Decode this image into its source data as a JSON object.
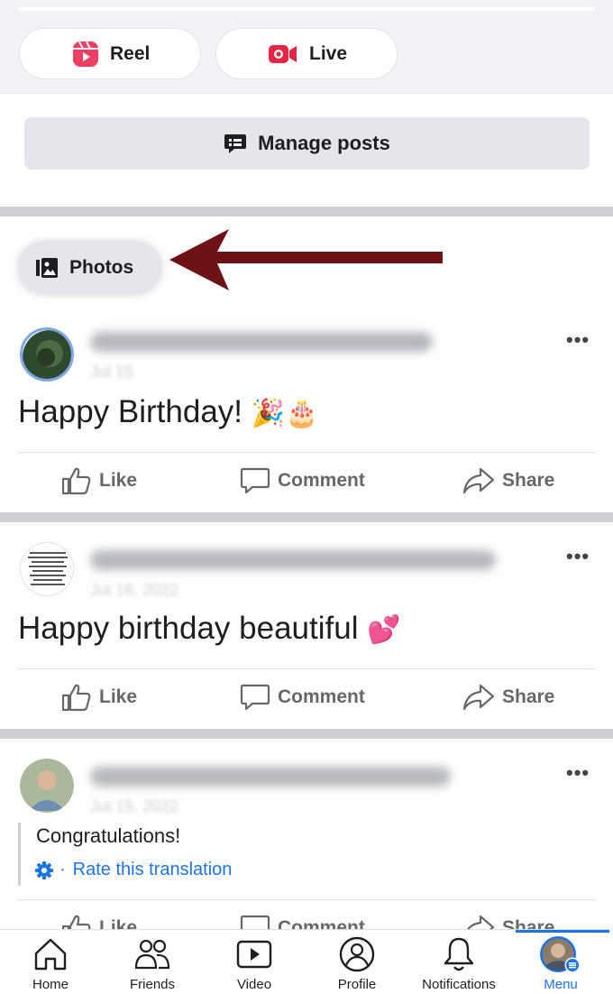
{
  "create_row": {
    "reel_label": "Reel",
    "live_label": "Live",
    "reel_icon": "reel-icon",
    "live_icon": "live-video-icon",
    "reel_color": "#ef3e63",
    "live_color": "#e42645"
  },
  "manage": {
    "label": "Manage posts",
    "icon": "speech-bubble-icon"
  },
  "photos": {
    "label": "Photos",
    "icon": "photo-album-icon",
    "annotation_color": "#6e1216"
  },
  "posts": [
    {
      "text": "Happy Birthday! ",
      "emoji": "🎉🎂",
      "date": "Jul 15"
    },
    {
      "text": "Happy birthday beautiful ",
      "emoji": "💕",
      "date": "Jul 16, 2022"
    },
    {
      "date": "Jul 15, 2022",
      "translation": "Congratulations!",
      "rate_translation": "Rate this translation"
    }
  ],
  "actions": {
    "like": "Like",
    "comment": "Comment",
    "share": "Share"
  },
  "nav": [
    {
      "label": "Home",
      "icon": "home-icon"
    },
    {
      "label": "Friends",
      "icon": "friends-icon"
    },
    {
      "label": "Video",
      "icon": "video-icon"
    },
    {
      "label": "Profile",
      "icon": "profile-icon"
    },
    {
      "label": "Notifications",
      "icon": "bell-icon"
    },
    {
      "label": "Menu",
      "icon": "menu-avatar-icon",
      "active": true
    }
  ],
  "colors": {
    "accent": "#1b74e4",
    "text_secondary": "#65676b"
  }
}
